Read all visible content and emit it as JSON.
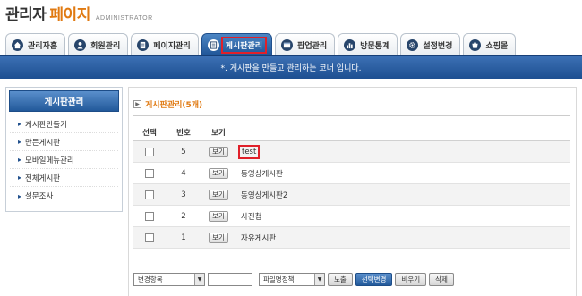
{
  "header": {
    "title_main": "관리자",
    "title_accent": "페이지",
    "title_sub": "ADMINISTRATOR"
  },
  "tabs": [
    {
      "label": "관리자홈",
      "icon": "home-icon"
    },
    {
      "label": "회원관리",
      "icon": "user-icon"
    },
    {
      "label": "페이지관리",
      "icon": "page-icon"
    },
    {
      "label": "게시판관리",
      "icon": "board-icon",
      "active": true
    },
    {
      "label": "팝업관리",
      "icon": "popup-icon"
    },
    {
      "label": "방문통계",
      "icon": "stats-icon"
    },
    {
      "label": "설정변경",
      "icon": "settings-icon"
    },
    {
      "label": "쇼핑몰",
      "icon": "shop-icon"
    }
  ],
  "banner": {
    "text": "*. 게시판을 만들고 관리하는 코너 입니다."
  },
  "sidebar": {
    "heading": "게시판관리",
    "items": [
      {
        "label": "게시판만들기"
      },
      {
        "label": "만든게시판"
      },
      {
        "label": "모바일메뉴관리"
      },
      {
        "label": "전체게시판"
      },
      {
        "label": "설문조사"
      }
    ]
  },
  "main": {
    "section_title": "게시판관리(5개)",
    "columns": {
      "select": "선택",
      "number": "번호",
      "view": "보기"
    },
    "view_button_label": "보기",
    "rows": [
      {
        "number": "5",
        "name": "test",
        "highlighted": true
      },
      {
        "number": "4",
        "name": "동영상게시판"
      },
      {
        "number": "3",
        "name": "동영상게시판2"
      },
      {
        "number": "2",
        "name": "사진첩"
      },
      {
        "number": "1",
        "name": "자유게시판"
      }
    ]
  },
  "bottom": {
    "change_item_select": "변경항목",
    "text_input_value": "",
    "file_policy_select": "파일명정책",
    "btn_expose": "노출",
    "btn_apply_change": "선택변경",
    "btn_empty": "비우기",
    "btn_delete": "삭제"
  },
  "colors": {
    "accent_orange": "#e07a12",
    "nav_blue": "#1f5597",
    "highlight_red": "#e0202a"
  }
}
